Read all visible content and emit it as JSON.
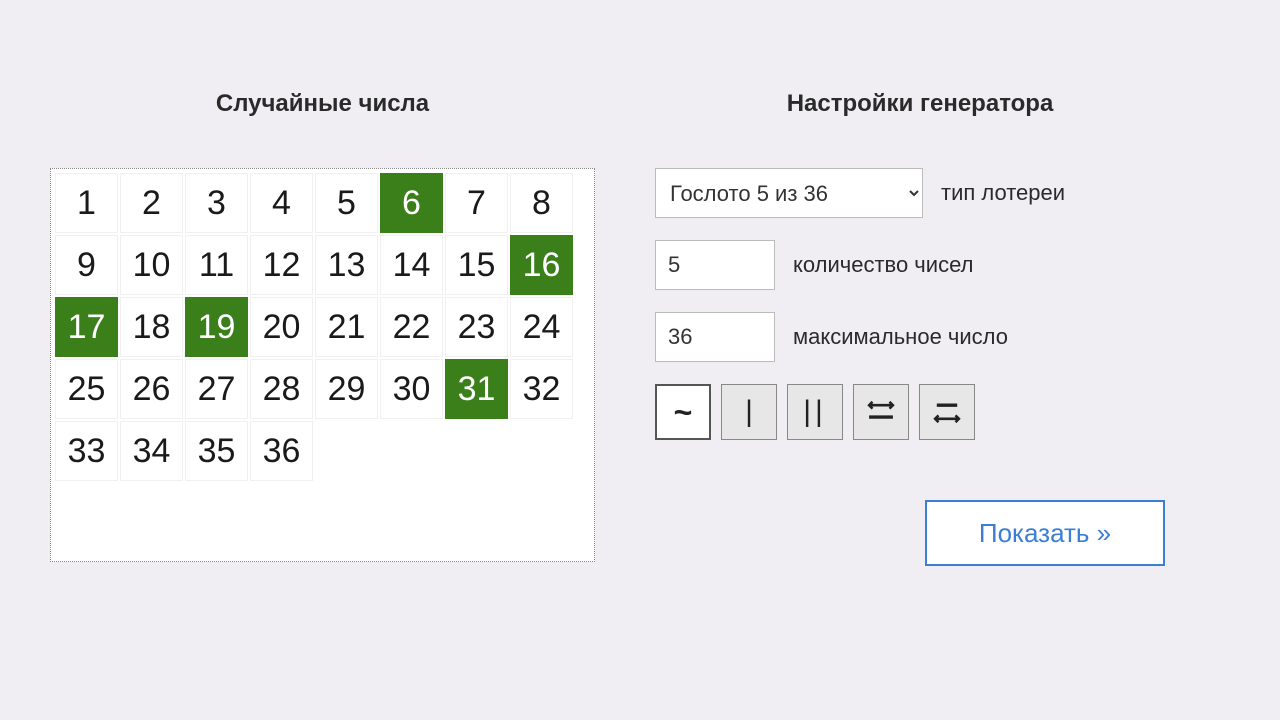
{
  "left": {
    "title": "Случайные числа",
    "grid": {
      "max": 36,
      "cols": 8,
      "selected": [
        6,
        16,
        17,
        19,
        31
      ]
    }
  },
  "right": {
    "title": "Настройки генератора",
    "lottery": {
      "selected": "Гослото 5 из 36",
      "label": "тип лотереи"
    },
    "count": {
      "value": "5",
      "label": "количество чисел"
    },
    "max": {
      "value": "36",
      "label": "максимальное число"
    },
    "tools": [
      {
        "id": "tilde",
        "active": true
      },
      {
        "id": "bar1",
        "active": false
      },
      {
        "id": "bar2",
        "active": false
      },
      {
        "id": "swap-h",
        "active": false
      },
      {
        "id": "swap-v",
        "active": false
      }
    ],
    "submit": "Показать »"
  }
}
